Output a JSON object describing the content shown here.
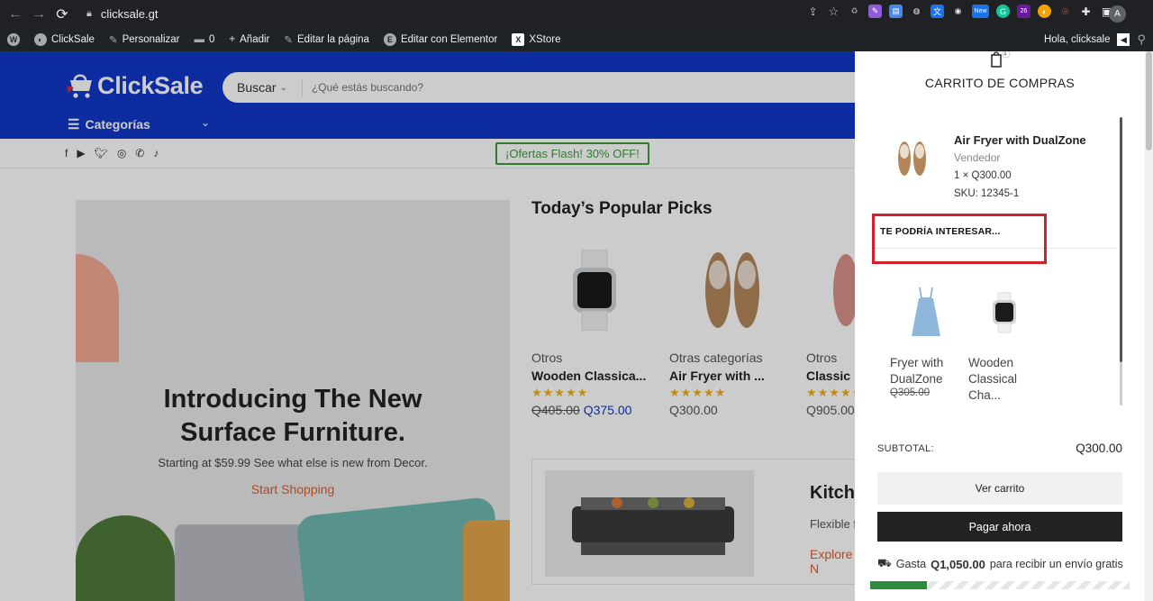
{
  "browser": {
    "url": "clicksale.gt",
    "profile_initial": "A",
    "ext_badge_new": "New",
    "ext_badge_count": "26"
  },
  "wp_bar": {
    "site_name": "ClickSale",
    "customize": "Personalizar",
    "comments_count": "0",
    "add_new": "Añadir",
    "edit_page": "Editar la página",
    "edit_elementor": "Editar con Elementor",
    "xstore": "XStore",
    "greeting": "Hola, clicksale"
  },
  "header": {
    "logo_text": "ClickSale",
    "search_category": "Buscar",
    "search_placeholder": "¿Qué estás buscando?",
    "categories_label": "Categorías",
    "flash_offer": "¡Ofertas Flash! 30% OFF!"
  },
  "hero": {
    "title_line1": "Introducing The New",
    "title_line2": "Surface Furniture.",
    "subtitle": "Starting at $59.99 See what else is new from Decor.",
    "cta": "Start Shopping"
  },
  "popular": {
    "title": "Today’s Popular Picks",
    "products": [
      {
        "category": "Otros",
        "name": "Wooden Classica...",
        "rating": "★★★★★",
        "old_price": "Q405.00",
        "price": "Q375.00"
      },
      {
        "category": "Otras categorías",
        "name": "Air Fryer with ...",
        "rating": "★★★★★",
        "price": "Q300.00"
      },
      {
        "category": "Otros",
        "name": "Classic",
        "rating": "★★★★★",
        "price": "Q905.00"
      }
    ]
  },
  "kitchen": {
    "title": "Kitche",
    "text": "Flexible f",
    "link": "Explore N"
  },
  "cart": {
    "count": "1",
    "title": "CARRITO DE COMPRAS",
    "item": {
      "name": "Air Fryer with DualZone",
      "vendor": "Vendedor",
      "qty_price": "1 × Q300.00",
      "sku": "SKU: 12345-1"
    },
    "interest_label": "TE PODRÍA INTERESAR...",
    "recommendations": [
      {
        "name_line1": "Fryer with",
        "name_line2": "DualZone",
        "price": "Q305.00"
      },
      {
        "name_line1": "Wooden",
        "name_line2": "Classical",
        "name_line3": "Cha..."
      }
    ],
    "subtotal_label": "SUBTOTAL:",
    "subtotal_value": "Q300.00",
    "view_cart": "Ver carrito",
    "pay_now": "Pagar ahora",
    "shipping_prefix": "Gasta",
    "shipping_amount": "Q1,050.00",
    "shipping_suffix": "para recibir un envío gratis",
    "shipping_progress": 0.22
  },
  "colors": {
    "brand_blue": "#0f37c9",
    "highlight_red": "#d31f2e",
    "flash_green": "#3d9b3d",
    "progress_green": "#2e8b3d"
  }
}
